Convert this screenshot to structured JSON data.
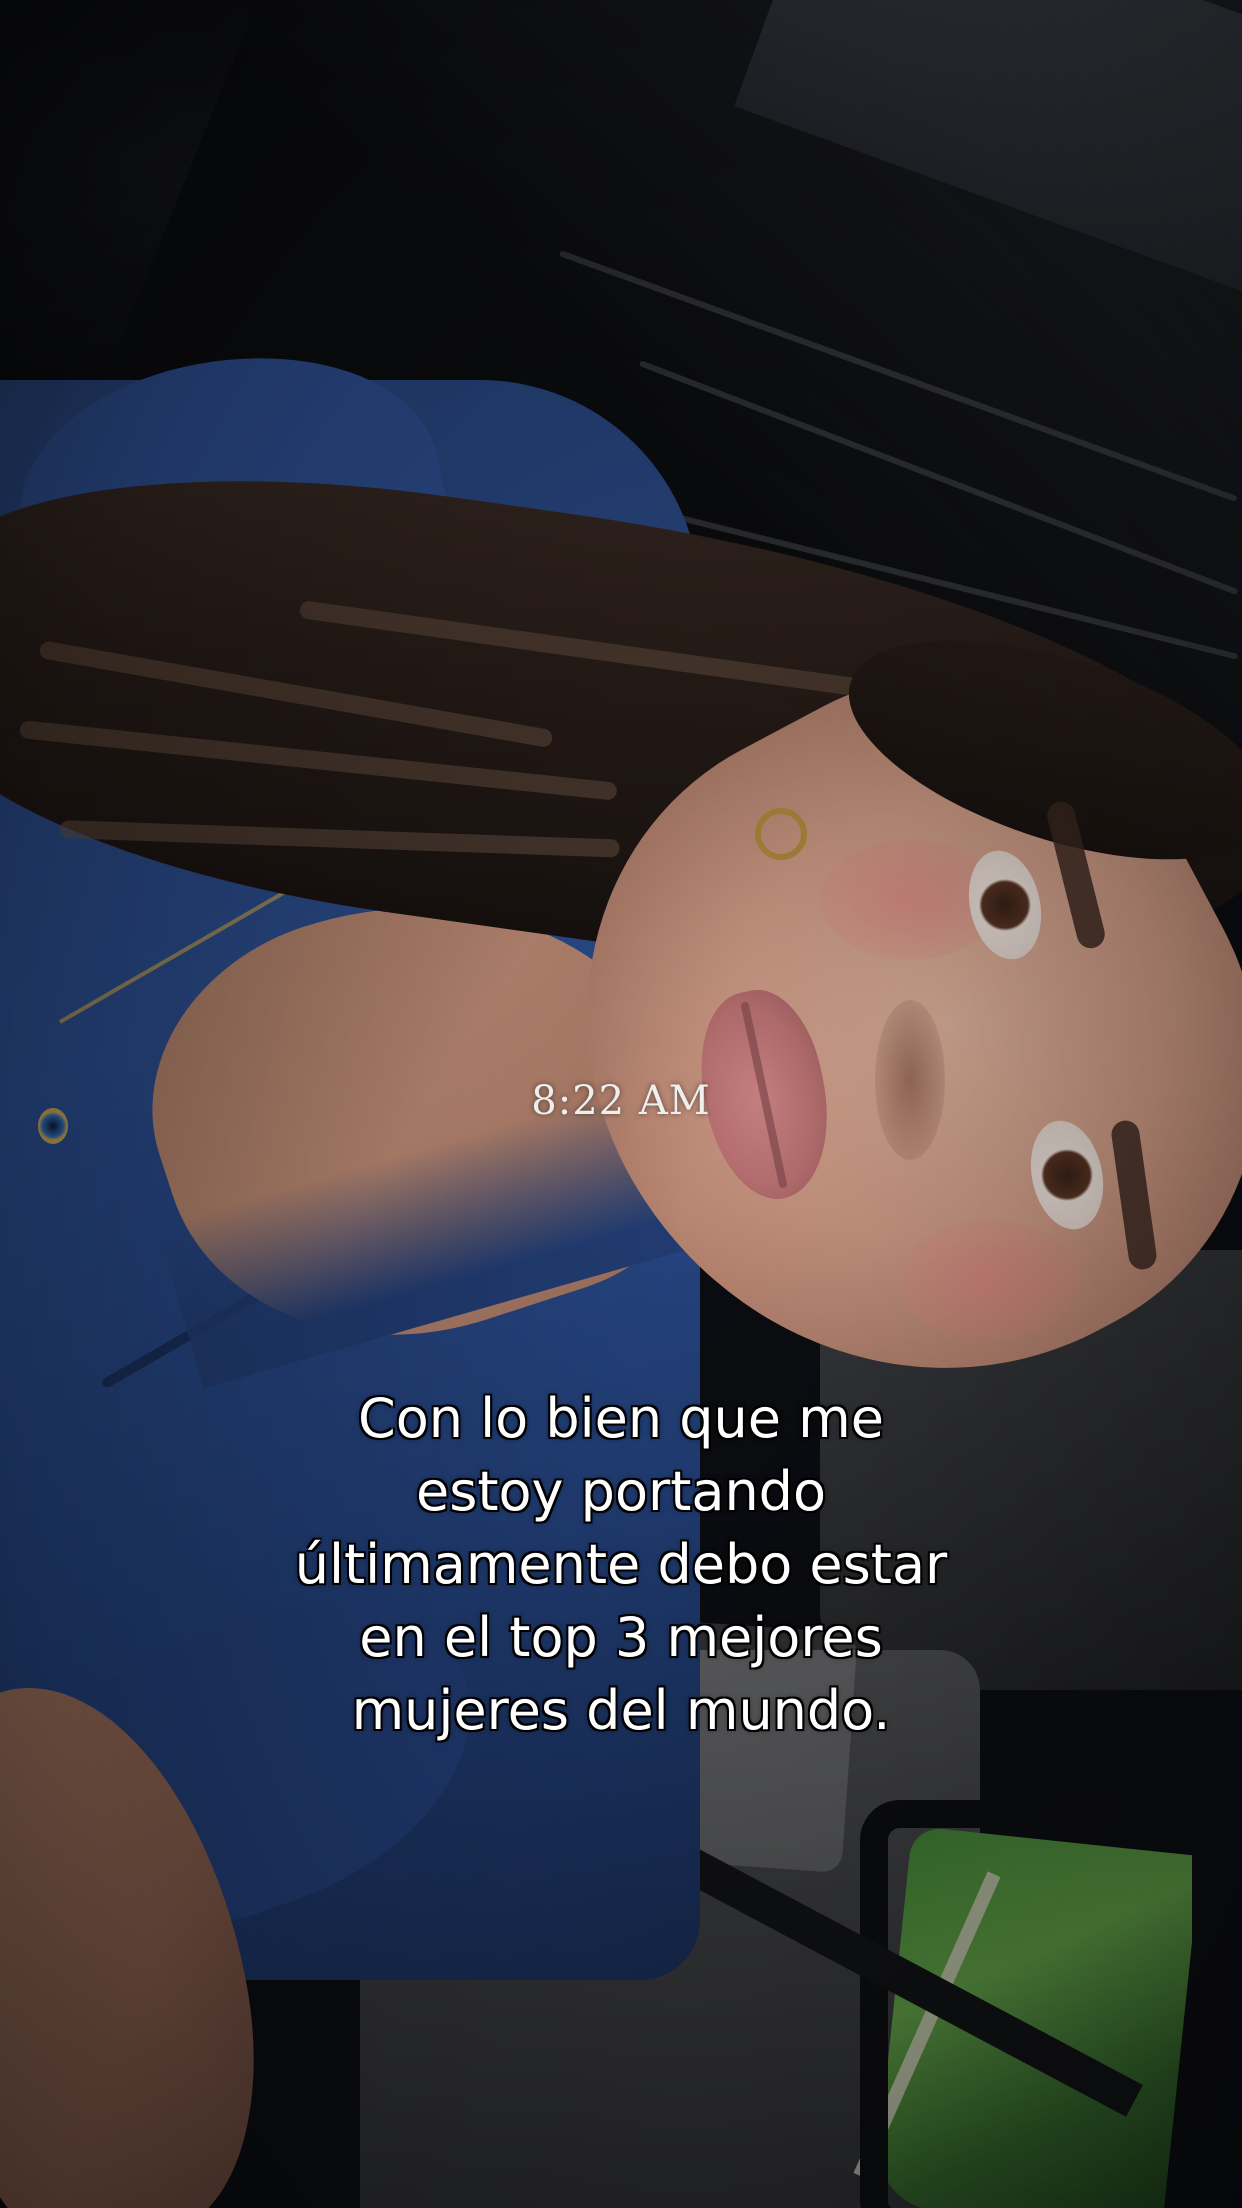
{
  "overlay": {
    "timestamp": "8:22 AM",
    "caption_lines": [
      "Con lo bien que me",
      "estoy portando",
      "últimamente debo estar",
      "en el top 3 mejores",
      "mujeres del mundo."
    ]
  },
  "colors": {
    "caption_text": "#ffffff",
    "caption_outline": "#000000",
    "timestamp_text": "#eeeeee",
    "shirt": "#2c4f92"
  }
}
